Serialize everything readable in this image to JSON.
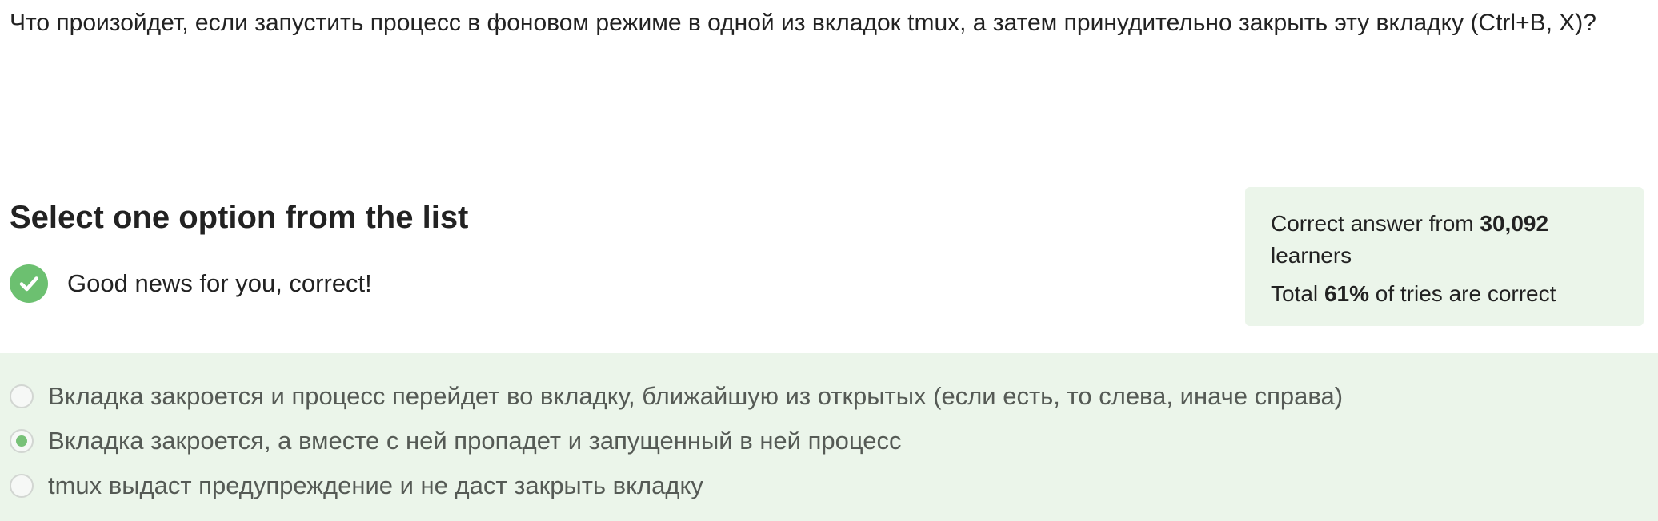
{
  "question": {
    "text": "Что произойдет, если запустить процесс в фоновом режиме в одной из вкладок tmux, а затем принудительно закрыть эту вкладку (Ctrl+B, X)?"
  },
  "section": {
    "title": "Select one option from the list"
  },
  "feedback": {
    "icon": "check-circle-icon",
    "text": "Good news for you, correct!",
    "color": "#6cc070"
  },
  "stats": {
    "correct_prefix": "Correct answer from",
    "learners_count": "30,092",
    "learners_suffix": "learners",
    "total_prefix": "Total",
    "percent": "61%",
    "total_suffix": "of tries are correct",
    "background": "#ebf5ea"
  },
  "options": [
    {
      "label": "Вкладка закроется и процесс перейдет во вкладку, ближайшую из открытых (если есть, то слева, иначе справа)",
      "selected": false
    },
    {
      "label": "Вкладка закроется, а вместе с ней пропадет и запущенный в ней процесс",
      "selected": true
    },
    {
      "label": "tmux выдаст предупреждение и не даст закрыть вкладку",
      "selected": false
    }
  ]
}
